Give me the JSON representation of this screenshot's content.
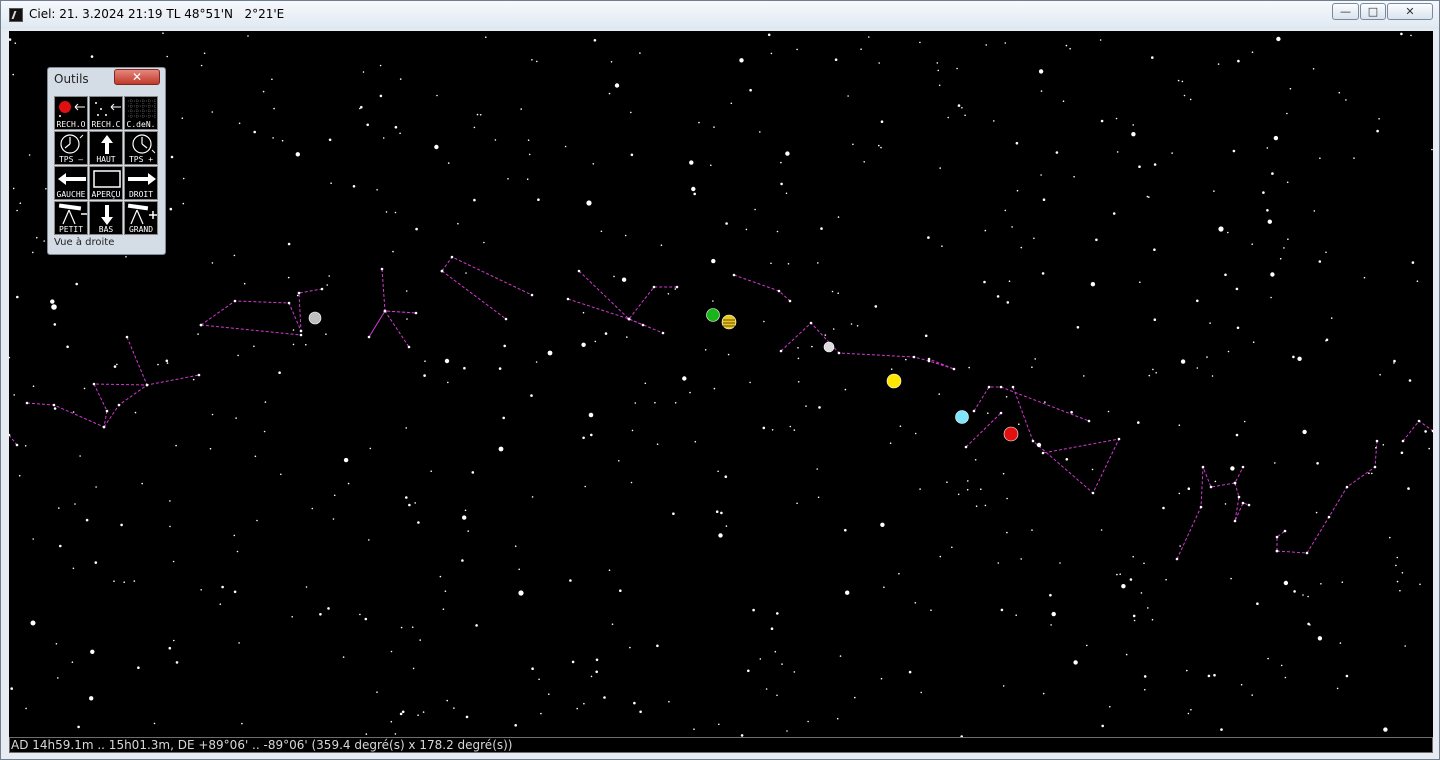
{
  "window": {
    "title": "Ciel: 21. 3.2024 21:19 TL 48°51'N   2°21'E",
    "minimize_label": "—",
    "maximize_label": "□",
    "close_label": "✕"
  },
  "statusbar": {
    "text": "AD 14h59.1m .. 15h01.3m, DE +89°06' .. -89°06' (359.4 degré(s) x 178.2 degré(s))"
  },
  "tools": {
    "title": "Outils",
    "close_label": "✕",
    "hint": "Vue à droite",
    "buttons": [
      {
        "label": "RECH.O",
        "icon": "search-object-icon"
      },
      {
        "label": "RECH.C",
        "icon": "search-constellation-icon"
      },
      {
        "label": "C.deN.",
        "icon": "grid-icon"
      },
      {
        "label": "TPS –",
        "icon": "clock-back-icon"
      },
      {
        "label": "HAUT",
        "icon": "arrow-up-icon"
      },
      {
        "label": "TPS +",
        "icon": "clock-forward-icon"
      },
      {
        "label": "GAUCHE",
        "icon": "arrow-left-icon"
      },
      {
        "label": "APERÇU",
        "icon": "preview-icon"
      },
      {
        "label": "DROIT",
        "icon": "arrow-right-icon"
      },
      {
        "label": "PETIT",
        "icon": "telescope-small-icon"
      },
      {
        "label": "BAS",
        "icon": "arrow-down-icon"
      },
      {
        "label": "GRAND",
        "icon": "telescope-large-icon"
      }
    ]
  },
  "colors": {
    "sky": "#000000",
    "constellation_lines": "#d23ad2",
    "star": "#ffffff",
    "planet_green": "#19b619",
    "planet_striped": "#e8c81a",
    "planet_yellow": "#ffe600",
    "planet_cyan": "#7fe5ff",
    "planet_red": "#e01010",
    "moon": "#bfbfbf"
  }
}
